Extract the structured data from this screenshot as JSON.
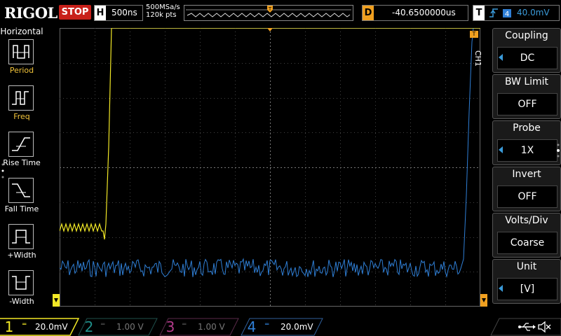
{
  "brand": "RIGOL",
  "run_state": "STOP",
  "horizontal": {
    "tag": "H",
    "timebase": "500ns",
    "sample_rate": "500MSa/s",
    "memory_depth": "120k pts"
  },
  "delay": {
    "tag": "D",
    "value": "-40.6500000us"
  },
  "trigger": {
    "tag": "T",
    "level": "40.0mV",
    "color": "#3a9ad9"
  },
  "left_menu": {
    "title": "Horizontal",
    "items": [
      {
        "label": "Period",
        "icon": "period-icon"
      },
      {
        "label": "Freq",
        "icon": "freq-icon"
      },
      {
        "label": "Rise Time",
        "icon": "rise-time-icon"
      },
      {
        "label": "Fall Time",
        "icon": "fall-time-icon"
      },
      {
        "label": "+Width",
        "icon": "positive-width-icon"
      },
      {
        "label": "-Width",
        "icon": "negative-width-icon"
      }
    ]
  },
  "right_menu": {
    "channel_tag": "CH1",
    "items": [
      {
        "title": "Coupling",
        "value": "DC"
      },
      {
        "title": "BW Limit",
        "value": "OFF"
      },
      {
        "title": "Probe",
        "value": "1X"
      },
      {
        "title": "Invert",
        "value": "OFF"
      },
      {
        "title": "Volts/Div",
        "value": "Coarse"
      },
      {
        "title": "Unit",
        "value": "[V]"
      }
    ]
  },
  "channels": [
    {
      "num": "1",
      "scale": "20.0mV",
      "color": "#f2e826",
      "active": true
    },
    {
      "num": "2",
      "scale": "1.00 V",
      "color": "#1f8f8a",
      "active": false
    },
    {
      "num": "3",
      "scale": "1.00 V",
      "color": "#b43c8c",
      "active": false
    },
    {
      "num": "4",
      "scale": "20.0mV",
      "color": "#2f7fd6",
      "active": true
    }
  ],
  "colors": {
    "ch1": "#f2e826",
    "ch4": "#2f7fd6",
    "trigger_marker": "#f0a020"
  }
}
